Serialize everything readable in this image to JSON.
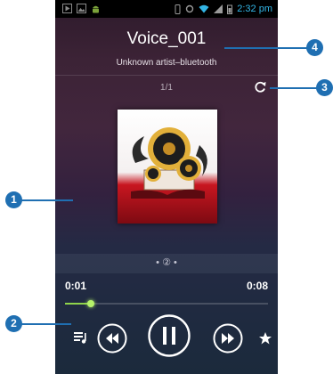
{
  "statusbar": {
    "time": "2:32 pm"
  },
  "player": {
    "title": "Voice_001",
    "subtitle": "Unknown artist–bluetooth",
    "track_position": "1/1",
    "pager": "•  ②  •",
    "current_time": "0:01",
    "total_time": "0:08",
    "progress_percent": 12.5,
    "accent_color": "#8fd34b"
  },
  "callouts": [
    {
      "number": "1"
    },
    {
      "number": "2"
    },
    {
      "number": "3"
    },
    {
      "number": "4"
    }
  ]
}
